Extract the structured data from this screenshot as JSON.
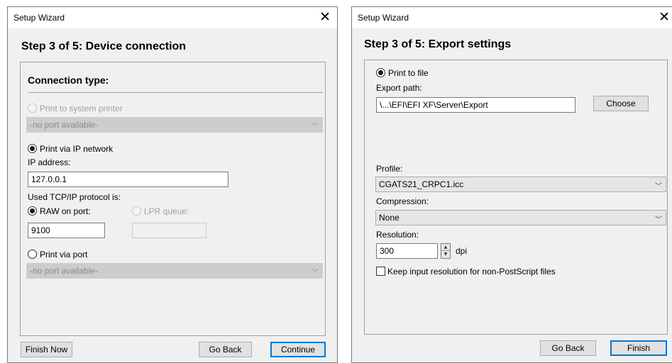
{
  "left_dialog": {
    "title": "Setup Wizard",
    "close_glyph": "✕",
    "heading": "Step 3 of 5: Device connection",
    "connection_type_label": "Connection type:",
    "system_printer_label": "Print to system printer",
    "system_printer_port": "-no port available-",
    "ip_network_label": "Print via IP network",
    "ip_address_label": "IP address:",
    "ip_address_value": "127.0.0.1",
    "protocol_label": "Used TCP/IP protocol is:",
    "raw_port_label": "RAW on port:",
    "raw_port_value": "9100",
    "lpr_queue_label": "LPR queue:",
    "lpr_queue_value": "",
    "via_port_label": "Print via port",
    "via_port_value": "-no port available-",
    "finish_now_button": "Finish Now",
    "go_back_button": "Go Back",
    "continue_button": "Continue"
  },
  "right_dialog": {
    "title": "Setup Wizard",
    "close_glyph": "✕",
    "heading": "Step 3 of 5: Export settings",
    "print_to_file_label": "Print to file",
    "export_path_label": "Export path:",
    "export_path_value": "\\...\\EFI\\EFI XF\\Server\\Export",
    "choose_button": "Choose",
    "profile_label": "Profile:",
    "profile_value": "CGATS21_CRPC1.icc",
    "compression_label": "Compression:",
    "compression_value": "None",
    "resolution_label": "Resolution:",
    "resolution_value": "300",
    "resolution_unit": "dpi",
    "keep_resolution_label": "Keep input resolution for non-PostScript files",
    "keep_resolution_checked": false,
    "go_back_button": "Go Back",
    "finish_button": "Finish"
  },
  "icons": {
    "close": "close-icon",
    "dropdown": "chevron-down-icon",
    "spin_up": "spin-up-icon",
    "spin_down": "spin-down-icon"
  },
  "colors": {
    "dialog_bg": "#f0f0f0",
    "titlebar_bg": "#ffffff",
    "default_button_border": "#0078d7",
    "disabled_text": "#a0a0a0"
  }
}
